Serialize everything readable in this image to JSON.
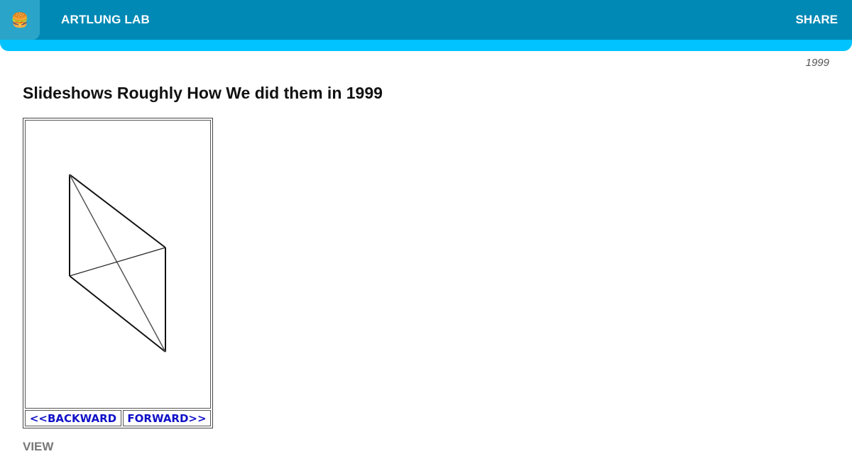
{
  "header": {
    "menu_icon": "hamburger-emoji-icon",
    "menu_glyph": "🍔",
    "site_title": "ARTLUNG LAB",
    "share_label": "SHARE",
    "colors": {
      "bar": "#0089b5",
      "accent_strip": "#00c3ff"
    }
  },
  "post": {
    "year": "1999",
    "title": "Slideshows Roughly How We did them in 1999"
  },
  "slideshow": {
    "back_label": "<<BACKWARD",
    "forward_label": "FORWARD>>",
    "link_color": "#1010c8"
  },
  "below": {
    "text": "VIEW"
  }
}
